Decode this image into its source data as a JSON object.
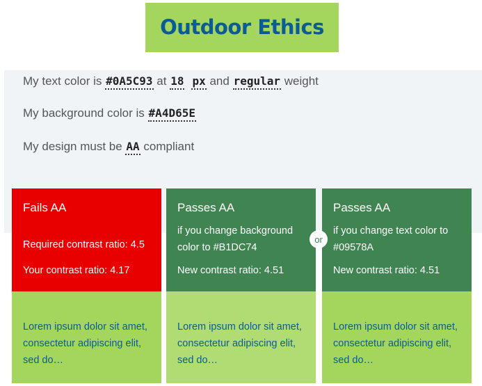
{
  "header": {
    "logo_text": "Outdoor Ethics"
  },
  "settings": {
    "line1_prefix": "My text color is",
    "text_color": "#0A5C93",
    "line1_at": "at",
    "font_size": "18",
    "font_unit": "px",
    "line1_and": "and",
    "weight": "regular",
    "line1_suffix": "weight",
    "line2_prefix": "My background color is",
    "bg_color": "#A4D65E",
    "line3_prefix": "My design must be",
    "level": "AA",
    "line3_suffix": "compliant"
  },
  "cards": [
    {
      "title": "Fails AA",
      "required": "Required contrast ratio: 4.5",
      "ratio": "Your contrast ratio: 4.17",
      "body": "Lorem ipsum dolor sit amet, consectetur adipiscing elit, sed do…"
    },
    {
      "title": "Passes AA",
      "subtitle": "if you change background color to #B1DC74",
      "ratio": "New contrast ratio: 4.51",
      "body": "Lorem ipsum dolor sit amet, consectetur adipiscing elit, sed do…"
    },
    {
      "title": "Passes AA",
      "subtitle": "if you change text color to #09578A",
      "ratio": "New contrast ratio: 4.51",
      "body": "Lorem ipsum dolor sit amet, consectetur adipiscing elit, sed do…"
    }
  ],
  "or_label": "or",
  "colors": {
    "fail_red": "#E80000",
    "pass_green": "#3F8451",
    "bg_green": "#A4D65E",
    "alt_bg_green": "#B1DC74",
    "text_blue": "#0A5C93",
    "panel_gray": "#F0F4F7"
  }
}
